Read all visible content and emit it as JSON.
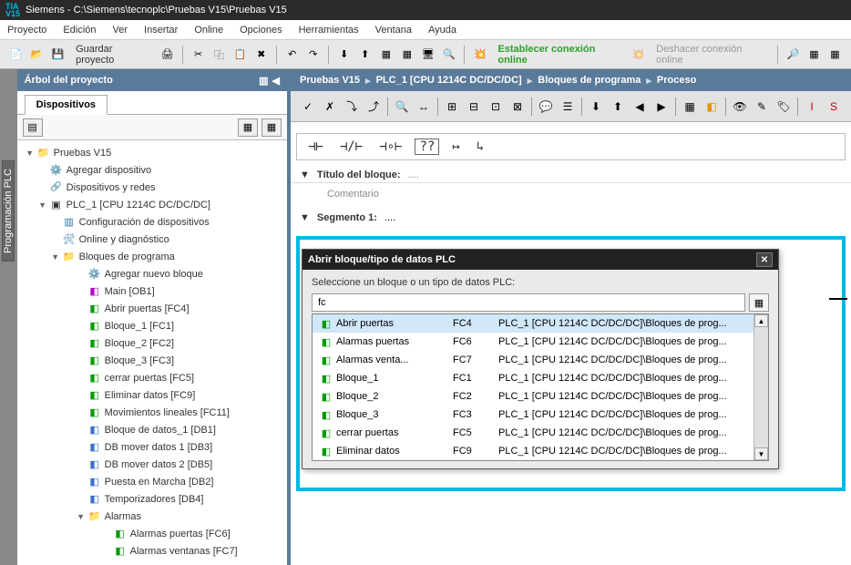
{
  "title_bar": "Siemens  -  C:\\Siemens\\tecnoplc\\Pruebas V15\\Pruebas V15",
  "menu": [
    "Proyecto",
    "Edición",
    "Ver",
    "Insertar",
    "Online",
    "Opciones",
    "Herramientas",
    "Ventana",
    "Ayuda"
  ],
  "toolbar": {
    "save_label": "Guardar proyecto",
    "online_label": "Establecer conexión online",
    "undo_online_label": "Deshacer conexión online"
  },
  "left": {
    "header": "Árbol del proyecto",
    "tab": "Dispositivos",
    "vtab": "Programación PLC"
  },
  "tree": [
    {
      "indent": 1,
      "arrow": "▼",
      "icon": "folder",
      "label": "Pruebas V15"
    },
    {
      "indent": 2,
      "arrow": "",
      "icon": "add",
      "label": "Agregar dispositivo"
    },
    {
      "indent": 2,
      "arrow": "",
      "icon": "device",
      "label": "Dispositivos y redes"
    },
    {
      "indent": 2,
      "arrow": "▼",
      "icon": "cpu",
      "label": "PLC_1 [CPU 1214C DC/DC/DC]"
    },
    {
      "indent": 3,
      "arrow": "",
      "icon": "config",
      "label": "Configuración de dispositivos"
    },
    {
      "indent": 3,
      "arrow": "",
      "icon": "online",
      "label": "Online y diagnóstico"
    },
    {
      "indent": 3,
      "arrow": "▼",
      "icon": "folder",
      "label": "Bloques de programa"
    },
    {
      "indent": 5,
      "arrow": "",
      "icon": "add",
      "label": "Agregar nuevo bloque"
    },
    {
      "indent": 5,
      "arrow": "",
      "icon": "main",
      "label": "Main [OB1]"
    },
    {
      "indent": 5,
      "arrow": "",
      "icon": "fc",
      "label": "Abrir puertas [FC4]"
    },
    {
      "indent": 5,
      "arrow": "",
      "icon": "fc",
      "label": "Bloque_1 [FC1]"
    },
    {
      "indent": 5,
      "arrow": "",
      "icon": "fc",
      "label": "Bloque_2 [FC2]"
    },
    {
      "indent": 5,
      "arrow": "",
      "icon": "fc",
      "label": "Bloque_3 [FC3]"
    },
    {
      "indent": 5,
      "arrow": "",
      "icon": "fc",
      "label": "cerrar puertas [FC5]"
    },
    {
      "indent": 5,
      "arrow": "",
      "icon": "fc",
      "label": "Eliminar datos [FC9]"
    },
    {
      "indent": 5,
      "arrow": "",
      "icon": "fc",
      "label": "Movimientos lineales [FC11]"
    },
    {
      "indent": 5,
      "arrow": "",
      "icon": "db",
      "label": "Bloque de datos_1 [DB1]"
    },
    {
      "indent": 5,
      "arrow": "",
      "icon": "db",
      "label": "DB mover datos 1 [DB3]"
    },
    {
      "indent": 5,
      "arrow": "",
      "icon": "db",
      "label": "DB mover datos 2 [DB5]"
    },
    {
      "indent": 5,
      "arrow": "",
      "icon": "db",
      "label": "Puesta en Marcha [DB2]"
    },
    {
      "indent": 5,
      "arrow": "",
      "icon": "db",
      "label": "Temporizadores [DB4]"
    },
    {
      "indent": 5,
      "arrow": "▼",
      "icon": "folder",
      "label": "Alarmas"
    },
    {
      "indent": 7,
      "arrow": "",
      "icon": "fc",
      "label": "Alarmas puertas [FC6]"
    },
    {
      "indent": 7,
      "arrow": "",
      "icon": "fc",
      "label": "Alarmas ventanas [FC7]"
    }
  ],
  "breadcrumb": [
    "Pruebas V15",
    "PLC_1 [CPU 1214C DC/DC/DC]",
    "Bloques de programa",
    "Proceso"
  ],
  "block_title": "Título del bloque:",
  "block_comment": "Comentario",
  "segment_label": "Segmento 1:",
  "dialog": {
    "title": "Abrir bloque/tipo de datos PLC",
    "instr": "Seleccione un bloque o un tipo de datos PLC:",
    "input": "fc",
    "rows": [
      {
        "name": "Abrir puertas",
        "code": "FC4",
        "path": "PLC_1 [CPU 1214C DC/DC/DC]\\Bloques de prog...",
        "sel": true
      },
      {
        "name": "Alarmas puertas",
        "code": "FC6",
        "path": "PLC_1 [CPU 1214C DC/DC/DC]\\Bloques de prog...",
        "sel": false
      },
      {
        "name": "Alarmas venta...",
        "code": "FC7",
        "path": "PLC_1 [CPU 1214C DC/DC/DC]\\Bloques de prog...",
        "sel": false
      },
      {
        "name": "Bloque_1",
        "code": "FC1",
        "path": "PLC_1 [CPU 1214C DC/DC/DC]\\Bloques de prog...",
        "sel": false
      },
      {
        "name": "Bloque_2",
        "code": "FC2",
        "path": "PLC_1 [CPU 1214C DC/DC/DC]\\Bloques de prog...",
        "sel": false
      },
      {
        "name": "Bloque_3",
        "code": "FC3",
        "path": "PLC_1 [CPU 1214C DC/DC/DC]\\Bloques de prog...",
        "sel": false
      },
      {
        "name": "cerrar puertas",
        "code": "FC5",
        "path": "PLC_1 [CPU 1214C DC/DC/DC]\\Bloques de prog...",
        "sel": false
      },
      {
        "name": "Eliminar datos",
        "code": "FC9",
        "path": "PLC_1 [CPU 1214C DC/DC/DC]\\Bloques de prog...",
        "sel": false
      }
    ]
  }
}
